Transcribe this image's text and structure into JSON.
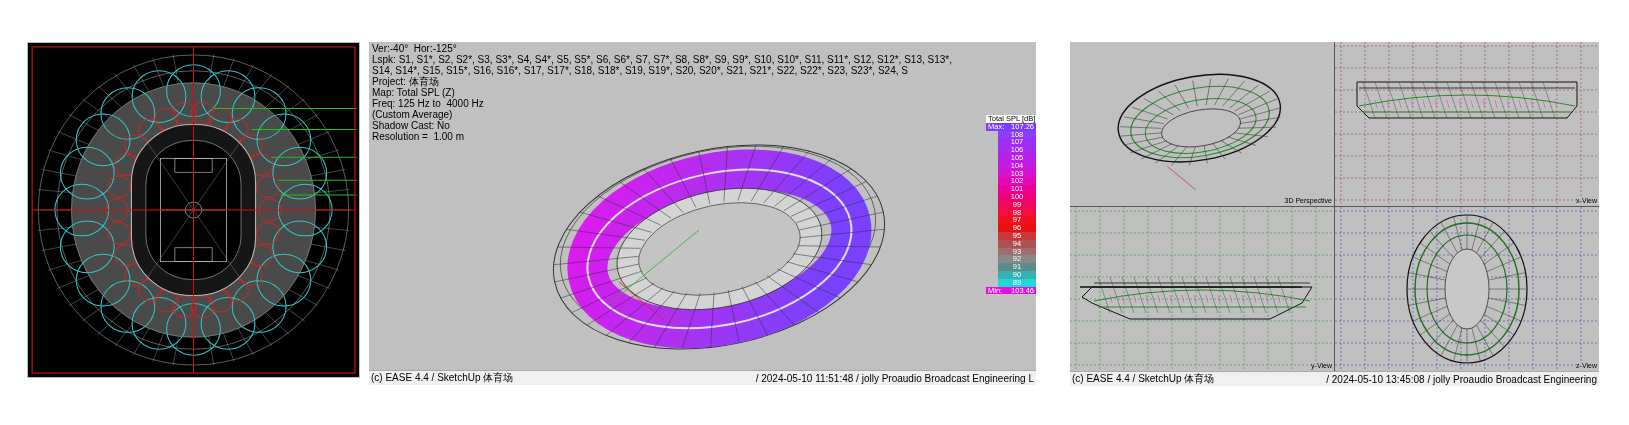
{
  "spl_view": {
    "info_lines": [
      "Ver:-40°  Hor:-125°",
      "Lspk: S1, S1*, S2, S2*, S3, S3*, S4, S4*, S5, S5*, S6, S6*, S7, S7*, S8, S8*, S9, S9*, S10, S10*, S11, S11*, S12, S12*, S13, S13*, S14, S14*, S15, S15*, S16, S16*, S17, S17*, S18, S18*, S19, S19*, S20, S20*, S21, S21*, S22, S22*, S23, S23*, S24, S",
      "Project: 体育场",
      "Map: Total SPL (Z)",
      "Freq: 125 Hz to  4000 Hz",
      "(Custom Average)",
      "Shadow Cast: No",
      "Resolution =  1.00 m"
    ],
    "legend": {
      "title": "Total SPL [dB]",
      "max_label": "Max:",
      "max_value": "107.26",
      "min_label": "Min:",
      "min_value": "103.46",
      "entries": [
        {
          "label": "108",
          "color": "#8a3cff"
        },
        {
          "label": "107",
          "color": "#9830f8"
        },
        {
          "label": "106",
          "color": "#a828f0"
        },
        {
          "label": "105",
          "color": "#b820e8"
        },
        {
          "label": "104",
          "color": "#c818e0"
        },
        {
          "label": "103",
          "color": "#d810d0"
        },
        {
          "label": "102",
          "color": "#e008b8"
        },
        {
          "label": "101",
          "color": "#e80098"
        },
        {
          "label": "100",
          "color": "#f00078"
        },
        {
          "label": "99",
          "color": "#f00858"
        },
        {
          "label": "98",
          "color": "#f01040"
        },
        {
          "label": "97",
          "color": "#f01020"
        },
        {
          "label": "96",
          "color": "#e81010"
        },
        {
          "label": "95",
          "color": "#c83838"
        },
        {
          "label": "94",
          "color": "#b05050"
        },
        {
          "label": "93",
          "color": "#a06c6c"
        },
        {
          "label": "92",
          "color": "#888888"
        },
        {
          "label": "91",
          "color": "#5a8c8c"
        },
        {
          "label": "90",
          "color": "#38b0b0"
        },
        {
          "label": "89",
          "color": "#20d8d8"
        }
      ]
    },
    "status_left": "(c) EASE 4.4  / SketchUp 体育场",
    "status_right": "/ 2024-05-10 11:51:48 / jolly Proaudio Broadcast Engineering L"
  },
  "views_panel": {
    "views": [
      {
        "label": "3D Perspective",
        "kind": "perspective"
      },
      {
        "label": "x-View",
        "kind": "x"
      },
      {
        "label": "y-View",
        "kind": "y"
      },
      {
        "label": "z-View",
        "kind": "z"
      }
    ],
    "status_left": "(c) EASE 4.4  / SketchUp 体育场",
    "status_right": "/ 2024-05-10 13:45:08 / jolly Proaudio Broadcast Engineering"
  }
}
